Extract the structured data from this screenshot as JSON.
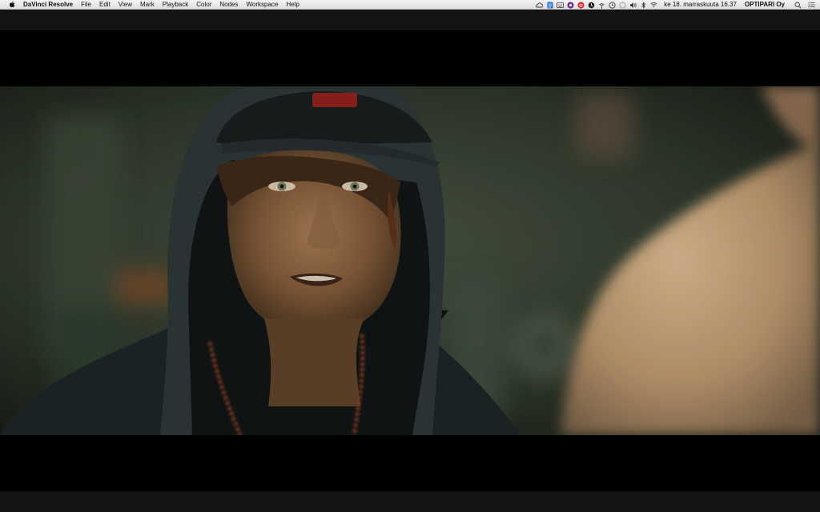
{
  "menubar": {
    "app_name": "DaVinci Resolve",
    "menus": [
      "File",
      "Edit",
      "View",
      "Mark",
      "Playback",
      "Color",
      "Nodes",
      "Workspace",
      "Help"
    ],
    "tray_icons": [
      "cloud-icon",
      "dropbox-icon",
      "keyboard-icon",
      "circle-icon",
      "vodafone-icon",
      "clock-icon",
      "broadcast-icon",
      "time-machine-icon",
      "volume-icon",
      "bluetooth-icon",
      "wifi-icon"
    ],
    "clock": "ke 18. marraskuuta  16.37",
    "user": "OPTIPARI Oy"
  },
  "viewer": {
    "frame_description_colors": {
      "background": "#2b3328",
      "letterbox": "#000000"
    }
  }
}
